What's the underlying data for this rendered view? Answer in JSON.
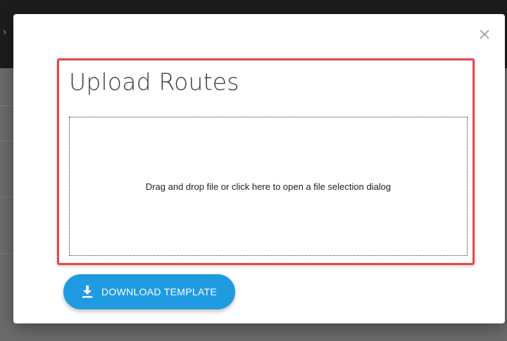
{
  "modal": {
    "title": "Upload Routes",
    "dropzone_text": "Drag and drop file or click here to open a file selection dialog",
    "download_button_label": "DOWNLOAD TEMPLATE",
    "close_icon": "close-icon",
    "download_icon": "download-icon"
  },
  "background": {
    "chevron_icon": "chevron-right-icon"
  },
  "colors": {
    "accent": "#1f9be2",
    "highlight": "#e5474a",
    "title_text": "#3b3b48"
  }
}
